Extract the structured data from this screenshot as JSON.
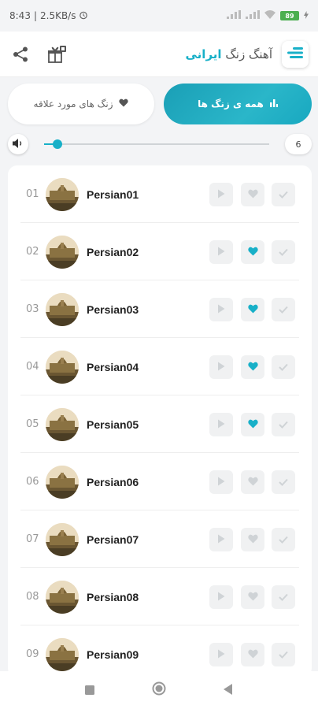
{
  "status_bar": {
    "time": "8:43",
    "speed": "2.5KB/s",
    "battery": "89"
  },
  "header": {
    "title_prefix": "آهنگ زنگ",
    "title_accent": "ایرانی"
  },
  "tabs": {
    "all_label": "همه ی زنگ ها",
    "favorites_label": "زنگ های مورد علاقه"
  },
  "volume": {
    "value": "6",
    "level": 0.06
  },
  "ringtones": [
    {
      "num": "01",
      "name": "Persian01",
      "favorite": false
    },
    {
      "num": "02",
      "name": "Persian02",
      "favorite": true
    },
    {
      "num": "03",
      "name": "Persian03",
      "favorite": true
    },
    {
      "num": "04",
      "name": "Persian04",
      "favorite": true
    },
    {
      "num": "05",
      "name": "Persian05",
      "favorite": true
    },
    {
      "num": "06",
      "name": "Persian06",
      "favorite": false
    },
    {
      "num": "07",
      "name": "Persian07",
      "favorite": false
    },
    {
      "num": "08",
      "name": "Persian08",
      "favorite": false
    },
    {
      "num": "09",
      "name": "Persian09",
      "favorite": false
    }
  ],
  "colors": {
    "accent": "#18b0c8",
    "inactive_icon": "#cfd3d6",
    "favorite": "#18b0c8"
  },
  "icons": [
    "share-icon",
    "gift-icon",
    "menu-icon",
    "heart-icon",
    "bars-icon",
    "volume-icon",
    "play-icon",
    "check-icon",
    "stop-icon",
    "home-icon",
    "back-icon"
  ]
}
